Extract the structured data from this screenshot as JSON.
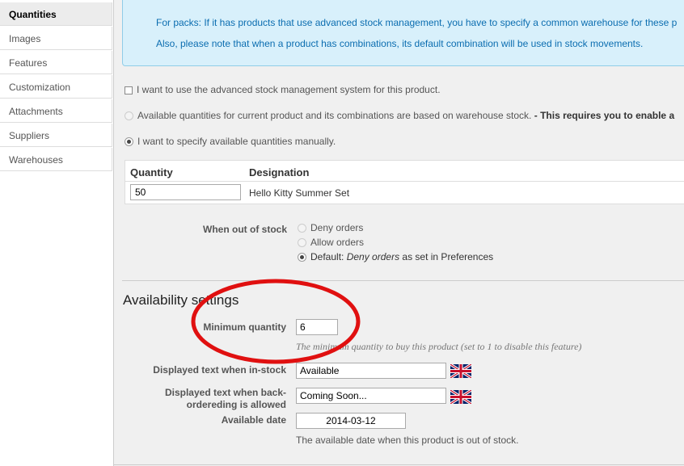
{
  "sidebar": {
    "items": [
      {
        "label": "Quantities",
        "active": true
      },
      {
        "label": "Images"
      },
      {
        "label": "Features"
      },
      {
        "label": "Customization"
      },
      {
        "label": "Attachments"
      },
      {
        "label": "Suppliers"
      },
      {
        "label": "Warehouses"
      }
    ]
  },
  "info": {
    "line1": "For packs: If it has products that use advanced stock management, you have to specify a common warehouse for these p",
    "line2": "Also, please note that when a product has combinations, its default combination will be used in stock movements."
  },
  "stock_options": {
    "advanced_label": "I want to use the advanced stock management system for this product.",
    "warehouse_label": "Available quantities for current product and its combinations are based on warehouse stock.",
    "warehouse_bold": " - This requires you to enable a",
    "manual_label": "I want to specify available quantities manually."
  },
  "quantity_table": {
    "col_quantity": "Quantity",
    "col_designation": "Designation",
    "row": {
      "quantity": "50",
      "designation": "Hello Kitty Summer Set"
    }
  },
  "out_of_stock": {
    "label": "When out of stock",
    "deny": "Deny orders",
    "allow": "Allow orders",
    "default_prefix": "Default: ",
    "default_em": "Deny orders",
    "default_suffix": " as set in Preferences"
  },
  "availability": {
    "title": "Availability settings",
    "min_qty_label": "Minimum quantity",
    "min_qty_value": "6",
    "min_qty_hint": "The minimum quantity to buy this product (set to 1 to disable this feature)",
    "in_stock_label": "Displayed text when in-stock",
    "in_stock_value": "Available",
    "backorder_label_1": "Displayed text when back-",
    "backorder_label_2": "ordereding is allowed",
    "backorder_value": "Coming Soon...",
    "date_label": "Available date",
    "date_value": "2014-03-12",
    "date_note": "The available date when this product is out of stock."
  },
  "colors": {
    "info_text": "#0b6db0",
    "info_bg": "#d8f0fb",
    "annotation_circle": "#e01010"
  },
  "icons": [
    "uk-flag-icon",
    "uk-flag-icon"
  ]
}
